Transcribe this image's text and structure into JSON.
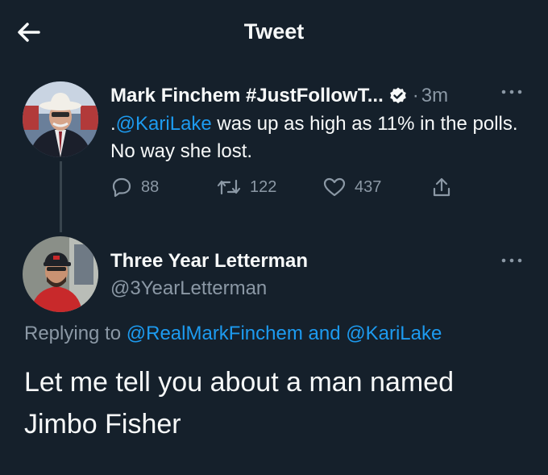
{
  "header": {
    "title": "Tweet"
  },
  "parent_tweet": {
    "display_name": "Mark Finchem #JustFollowT...",
    "time_sep": "·",
    "time": "3m",
    "text_prefix": ".",
    "mention": "@KariLake",
    "text_rest": " was up as high as 11% in the polls. No way she lost.",
    "reply_count": "88",
    "retweet_count": "122",
    "like_count": "437"
  },
  "reply_tweet": {
    "display_name": "Three Year Letterman",
    "handle": "@3YearLetterman",
    "replying_prefix": "Replying to ",
    "replying_mention_1": "@RealMarkFinchem",
    "replying_and": " and ",
    "replying_mention_2": "@KariLake",
    "text": "Let me tell you about a man named Jimbo Fisher"
  },
  "colors": {
    "background": "#15202b",
    "text": "#f7f9f9",
    "muted": "#8b98a5",
    "accent": "#1d9bf0"
  },
  "icons": {
    "back": "back-arrow-icon",
    "verified": "verified-badge-icon",
    "more": "more-icon",
    "reply": "reply-icon",
    "retweet": "retweet-icon",
    "like": "heart-icon",
    "share": "share-icon"
  }
}
